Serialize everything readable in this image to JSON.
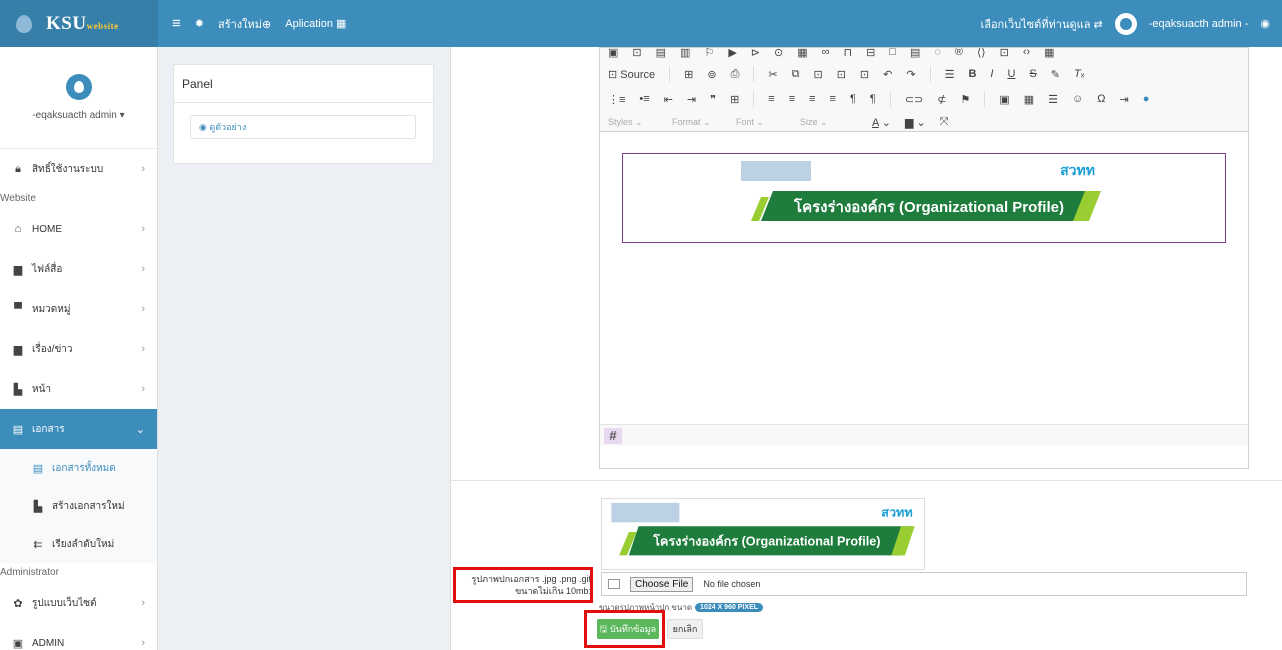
{
  "header": {
    "brand": "KSU",
    "brand_suffix": "website",
    "create_label": "สร้างใหม่⊕",
    "app_label": "Aplication ▦",
    "site_select": "เลือกเว็บไซต์ที่ท่านดูแล ⇄",
    "user": "-eqaksuacth admin -"
  },
  "sidebar": {
    "user_name": "-eqaksuacth admin ▾",
    "permission": "สิทธิ์ใช้งานระบบ",
    "section_website": "Website",
    "items": [
      {
        "label": "HOME",
        "icon": "home-icon"
      },
      {
        "label": "ไฟล์สื่อ",
        "icon": "media-icon"
      },
      {
        "label": "หมวดหมู่",
        "icon": "category-icon"
      },
      {
        "label": "เรื่อง/ข่าว",
        "icon": "news-icon"
      },
      {
        "label": "หน้า",
        "icon": "page-icon"
      },
      {
        "label": "เอกสาร",
        "icon": "document-icon"
      }
    ],
    "sub_items": [
      {
        "label": "เอกสารทั้งหมด"
      },
      {
        "label": "สร้างเอกสารใหม่"
      },
      {
        "label": "เรียงลำดับใหม่"
      }
    ],
    "section_admin": "Administrator",
    "admin_items": [
      {
        "label": "รูปแบบเว็บไซต์"
      },
      {
        "label": "ADMIN"
      }
    ]
  },
  "panel": {
    "title": "Panel",
    "preview_button": "◉ ดูตัวอย่าง"
  },
  "editor": {
    "source_label": "Source",
    "styles_label": "Styles",
    "format_label": "Format",
    "font_label": "Font",
    "size_label": "Size",
    "banner_title": "โครงร่างองค์กร (Organizational Profile)",
    "banner_logo": "สวทท"
  },
  "upload": {
    "label_line1": "รูปภาพปกเอกสาร .jpg .png .gif",
    "label_line2": "ขนาดไม่เกิน 10mb:",
    "choose_file": "Choose File",
    "no_file": "No file chosen",
    "size_hint": "ขนาดรูปภาพหน้าปก ขนาด",
    "size_badge": "1024 X 960 PIXEL"
  },
  "actions": {
    "save": "🖫 บันทึกข้อมูล",
    "cancel": "ยกเลิก"
  }
}
